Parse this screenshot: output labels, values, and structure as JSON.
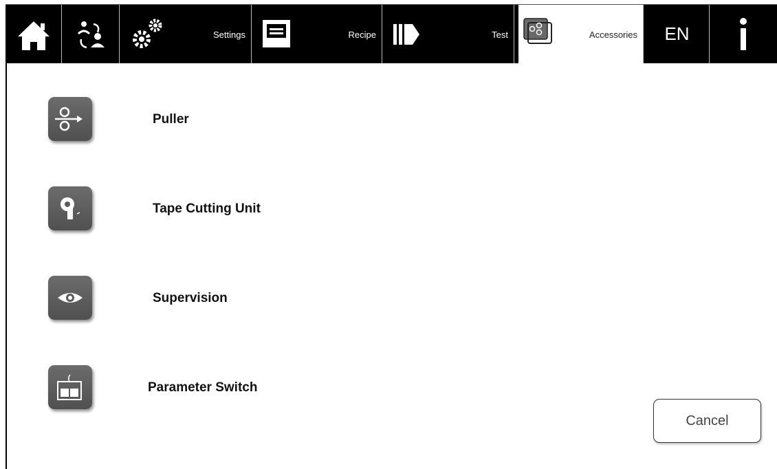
{
  "nav": {
    "home_icon": "home-icon",
    "users_icon": "user-change-icon",
    "settings": {
      "label": "Settings",
      "icon": "gears-icon"
    },
    "recipe": {
      "label": "Recipe",
      "icon": "recipe-icon"
    },
    "test": {
      "label": "Test",
      "icon": "test-play-icon"
    },
    "accessories": {
      "label": "Accessories",
      "icon": "accessories-icon",
      "active": true
    },
    "language": "EN",
    "info": "i"
  },
  "accessories": [
    {
      "label": "Puller",
      "icon": "puller-icon"
    },
    {
      "label": "Tape Cutting Unit",
      "icon": "tape-cutting-icon"
    },
    {
      "label": "Supervision",
      "icon": "eye-icon"
    },
    {
      "label": "Parameter Switch",
      "icon": "parameter-switch-icon"
    }
  ],
  "cancel_label": "Cancel",
  "colors": {
    "bar": "#000000",
    "icon_bg": "#5e5e5e",
    "active_tab": "#ffffff"
  }
}
